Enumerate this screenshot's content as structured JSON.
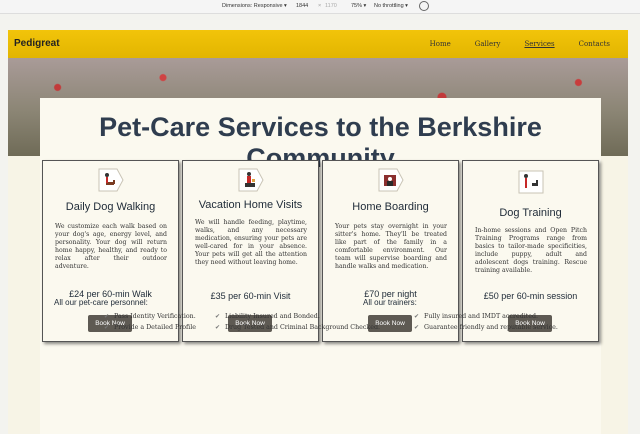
{
  "devtools": {
    "dimensions_label": "Dimensions: Responsive ▾",
    "width": "1844",
    "times": "×",
    "height": "1170",
    "zoom": "75% ▾",
    "throttling": "No throttling ▾"
  },
  "nav": {
    "brand": "Pedigreat",
    "links": [
      "Home",
      "Gallery",
      "Services",
      "Contacts"
    ],
    "active": "Services"
  },
  "main_title": "Pet-Care Services to the Berkshire Community",
  "services": [
    {
      "title": "Daily Dog Walking",
      "description": "We customize each walk based on your dog's age, energy level, and personality. Your dog will return home happy, healthy, and ready to relax after their outdoor adventure.",
      "price": "£24 per 60-min Walk",
      "button": "Book Now",
      "icon": "dog-walking-icon"
    },
    {
      "title": "Vacation Home Visits",
      "description": "We will handle feeding, playtime, walks, and any necessary medication, ensuring your pets are well-cared for in your absence. Your pets will get all the attention they need without leaving home.",
      "price": "£35 per 60-min Visit",
      "button": "Book Now",
      "icon": "home-visit-icon"
    },
    {
      "title": "Home Boarding",
      "description": "Your pets stay overnight in your sitter's home. They'll be treated like part of the family in a comfortable environment. Our team will supervise boarding and handle walks and medication.",
      "price": "£70 per night",
      "button": "Book Now",
      "icon": "home-boarding-icon"
    },
    {
      "title": "Dog Training",
      "description": "In-home sessions and Open Pitch Training Programs range from basics to tailor-made specificities, include puppy, adult and adolescent dogs training. Rescue training available.",
      "price": "£50 per 60-min session",
      "button": "Book Now",
      "icon": "dog-training-icon"
    }
  ],
  "personnel": {
    "heading": "All our pet-care personnel:",
    "col1": [
      "Pass Identity Verification.",
      "Provide a Detailed Profile"
    ],
    "col2": [
      "Liability Insured and Bonded.",
      "Drug Tested and Criminal Background Checked."
    ]
  },
  "trainers": {
    "heading": "All our trainers:",
    "items": [
      "Fully insured and IMDT accredited.",
      "Guarantee friendly and reputable service."
    ]
  },
  "colors": {
    "navbar": "#f2c40a",
    "title": "#2f3d4f",
    "button": "#5e5a53"
  }
}
